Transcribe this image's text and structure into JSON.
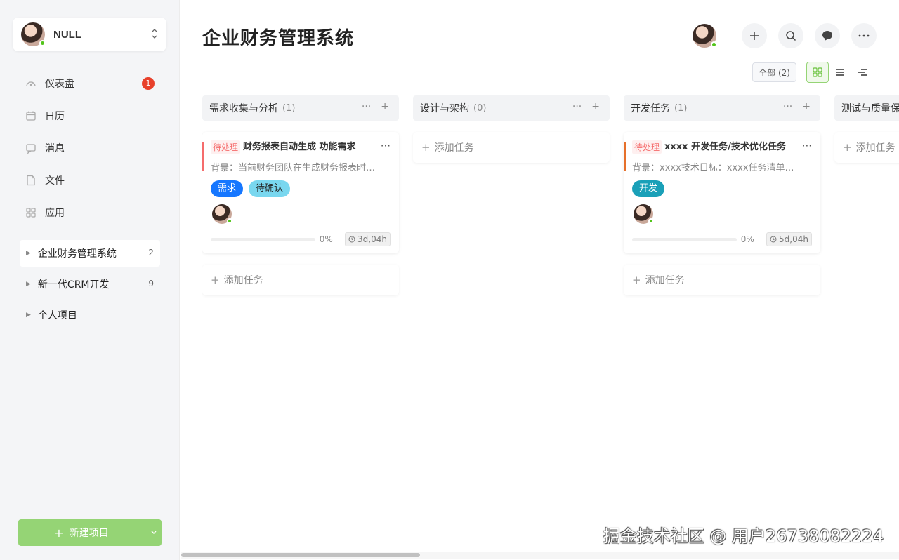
{
  "user": {
    "name": "NULL"
  },
  "nav": [
    {
      "label": "仪表盘",
      "icon": "dashboard-icon",
      "badge": "1"
    },
    {
      "label": "日历",
      "icon": "calendar-icon"
    },
    {
      "label": "消息",
      "icon": "message-icon"
    },
    {
      "label": "文件",
      "icon": "file-icon"
    },
    {
      "label": "应用",
      "icon": "apps-icon"
    }
  ],
  "projects": [
    {
      "label": "企业财务管理系统",
      "count": "2"
    },
    {
      "label": "新一代CRM开发",
      "count": "9"
    },
    {
      "label": "个人项目",
      "count": ""
    }
  ],
  "new_project_label": "新建项目",
  "page_title": "企业财务管理系统",
  "filter_label": "全部 (2)",
  "columns": [
    {
      "title": "需求收集与分析",
      "count": "(1)"
    },
    {
      "title": "设计与架构",
      "count": "(0)"
    },
    {
      "title": "开发任务",
      "count": "(1)"
    },
    {
      "title": "测试与质量保",
      "count": ""
    }
  ],
  "cards": [
    {
      "status": "待处理",
      "title": "财务报表自动生成  功能需求",
      "desc": "背景：当前财务团队在生成财务报表时…",
      "tags": [
        "需求",
        "待确认"
      ],
      "progress": 0,
      "progress_label": "0%",
      "time": "3d,04h"
    },
    {
      "status": "待处理",
      "title": "xxxx  开发任务/技术优化任务",
      "desc": "背景：xxxx技术目标：xxxx任务清单…",
      "tags": [
        "开发"
      ],
      "progress": 0,
      "progress_label": "0%",
      "time": "5d,04h"
    }
  ],
  "add_task_label": "添加任务",
  "watermark": "掘金技术社区 @ 用户26738082224",
  "colors": {
    "accent_green": "#95d475",
    "status_red": "#f56c6c",
    "tag_blue": "#1677ff",
    "tag_cyan": "#79d7ef",
    "tag_teal": "#1aa0b8",
    "badge_red": "#e8412b"
  }
}
